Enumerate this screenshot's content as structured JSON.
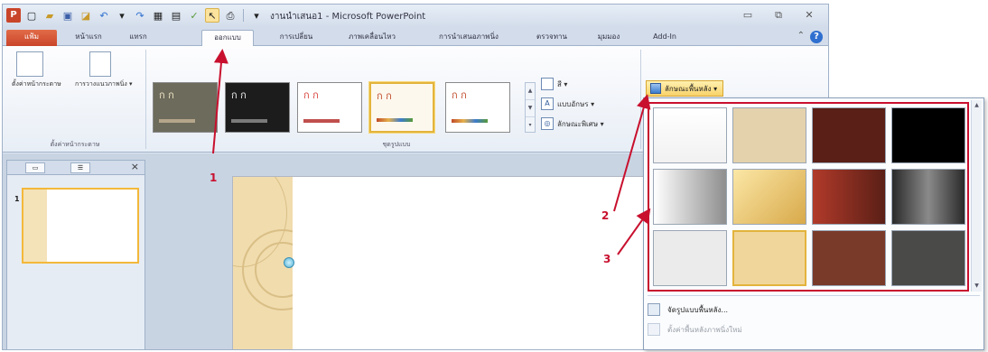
{
  "window": {
    "title": "งานนำเสนอ1 - Microsoft PowerPoint",
    "app_icon": "P",
    "controls": [
      "▭",
      "⧉",
      "✕"
    ]
  },
  "tabs": [
    {
      "label": "แฟ้ม"
    },
    {
      "label": "หน้าแรก"
    },
    {
      "label": "แทรก"
    },
    {
      "label": "ออกแบบ"
    },
    {
      "label": "การเปลี่ยน"
    },
    {
      "label": "ภาพเคลื่อนไหว"
    },
    {
      "label": "การนำเสนอภาพนิ่ง"
    },
    {
      "label": "ตรวจทาน"
    },
    {
      "label": "มุมมอง"
    },
    {
      "label": "Add-In"
    }
  ],
  "ribbon": {
    "page_setup": {
      "label": "ตั้งค่าหน้ากระดาษ",
      "group": "ตั้งค่าหน้ากระดาษ"
    },
    "orientation": {
      "label": "การวางแนวภาพนิ่ง ▾"
    },
    "themes_group": "ชุดรูปแบบ",
    "theme_sample": "ก ก",
    "colors": {
      "label": "สี ▾"
    },
    "fonts": {
      "label": "แบบอักษร ▾",
      "glyph": "A"
    },
    "effects": {
      "label": "ลักษณะพิเศษ ▾",
      "glyph": "◎"
    },
    "bg_styles": {
      "label": "ลักษณะพื้นหลัง ▾"
    }
  },
  "theme_colors": [
    "#6d6b5b",
    "#1c1c1c",
    "#ffffff",
    "#fdf8ee",
    "#ffffff"
  ],
  "theme_text_colors": [
    "#f0e6c8",
    "#f0f0f0",
    "#d8443b",
    "#c04b2a",
    "#c04b2a"
  ],
  "side_panel": {
    "slide_number": "1"
  },
  "backgrounds": [
    {
      "color": "linear-gradient(#ffffff,#f1f1f1)"
    },
    {
      "color": "#e4d2ad"
    },
    {
      "color": "#5a1f16"
    },
    {
      "color": "#000000"
    },
    {
      "color": "linear-gradient(90deg,#ffffff,#8e8e8e)"
    },
    {
      "color": "linear-gradient(135deg,#fbe7a6,#d8a94a)"
    },
    {
      "color": "linear-gradient(90deg,#b13a2a,#5a1f16)"
    },
    {
      "color": "linear-gradient(90deg,#2a2a2a,#8a8a8a,#2a2a2a)"
    },
    {
      "color": "#ebebeb"
    },
    {
      "color": "#f1d69b"
    },
    {
      "color": "#7a3a2a"
    },
    {
      "color": "#4a4a48"
    }
  ],
  "bg_menu": {
    "format_label": "จัดรูปแบบพื้นหลัง...",
    "reset_label": "ตั้งค่าพื้นหลังภาพนิ่งใหม่"
  },
  "annotations": [
    "1",
    "2",
    "3"
  ]
}
